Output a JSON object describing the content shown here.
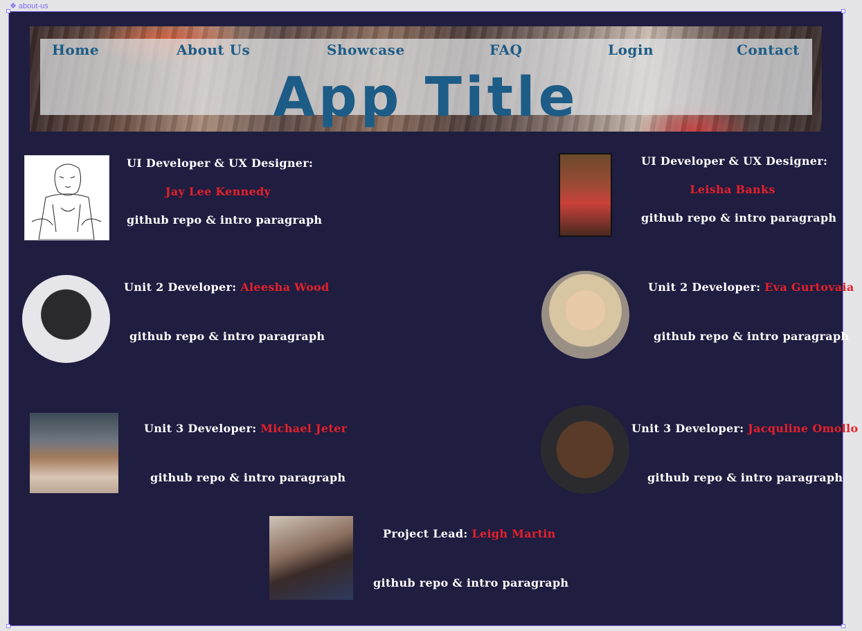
{
  "frame": {
    "label": "about-us"
  },
  "nav": {
    "items": [
      {
        "label": "Home"
      },
      {
        "label": "About Us"
      },
      {
        "label": "Showcase"
      },
      {
        "label": "FAQ"
      },
      {
        "label": "Login"
      },
      {
        "label": "Contact"
      }
    ]
  },
  "banner": {
    "title": "App Title"
  },
  "team": {
    "jay": {
      "role": "UI Developer & UX Designer:",
      "name": "Jay Lee Kennedy",
      "info": "github repo & intro paragraph"
    },
    "leisha": {
      "role": "UI Developer & UX Designer:",
      "name": "Leisha Banks",
      "info": "github repo & intro paragraph"
    },
    "aleesha": {
      "role": "Unit 2 Developer:",
      "name": "Aleesha Wood",
      "info": "github repo & intro paragraph"
    },
    "eva": {
      "role": "Unit 2 Developer:",
      "name": "Eva Gurtovaia",
      "info": "github repo & intro paragraph"
    },
    "michael": {
      "role": "Unit 3 Developer:",
      "name": "Michael Jeter",
      "info": "github repo & intro paragraph"
    },
    "jacq": {
      "role": "Unit 3 Developer:",
      "name": "Jacquline Omollo",
      "info": "github repo & intro paragraph"
    },
    "leigh": {
      "role": "Project Lead:",
      "name": "Leigh Martin",
      "info": "github repo & intro paragraph"
    }
  },
  "colors": {
    "background": "#1f1d40",
    "name": "#e5202a",
    "nav": "#1d5c86",
    "selection": "#8e80f5"
  }
}
